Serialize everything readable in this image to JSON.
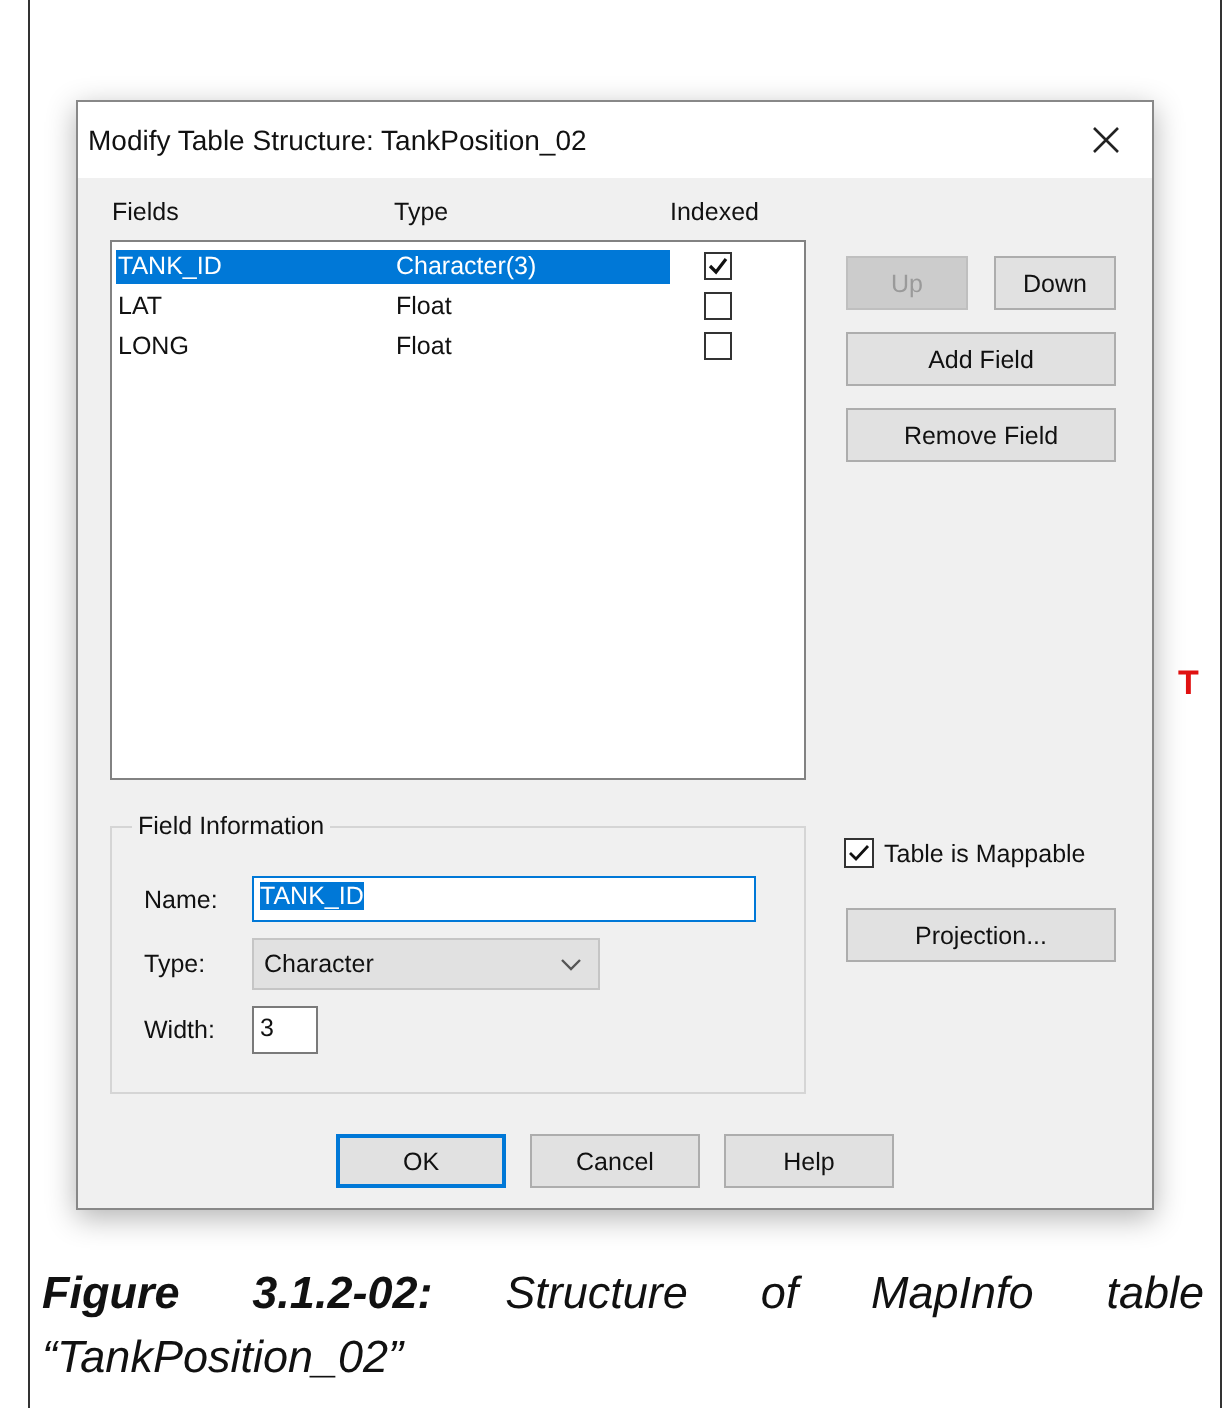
{
  "window": {
    "title": "Modify Table Structure: TankPosition_02"
  },
  "columns": [
    "Fields",
    "Type",
    "Indexed"
  ],
  "rows": [
    {
      "name": "TANK_ID",
      "type": "Character(3)",
      "indexed": true,
      "selected": true
    },
    {
      "name": "LAT",
      "type": "Float",
      "indexed": false,
      "selected": false
    },
    {
      "name": "LONG",
      "type": "Float",
      "indexed": false,
      "selected": false
    }
  ],
  "move_buttons": [
    {
      "label": "Up",
      "disabled": true
    },
    {
      "label": "Down",
      "disabled": false
    }
  ],
  "field_buttons": [
    "Add Field",
    "Remove Field"
  ],
  "field_information": {
    "title": "Field Information",
    "name_label": "Name:",
    "name_value": "TANK_ID",
    "type_label": "Type:",
    "type_value": "Character",
    "width_label": "Width:",
    "width_value": "3"
  },
  "mappable": {
    "label": "Table is Mappable",
    "checked": true
  },
  "projection_button": "Projection...",
  "footer_buttons": [
    {
      "label": "OK",
      "default": true
    },
    {
      "label": "Cancel",
      "default": false
    },
    {
      "label": "Help",
      "default": false
    }
  ],
  "stray_text": "T",
  "caption": "**Figure 3.1.2-02:** Structure of MapInfo table “TankPosition_02”"
}
